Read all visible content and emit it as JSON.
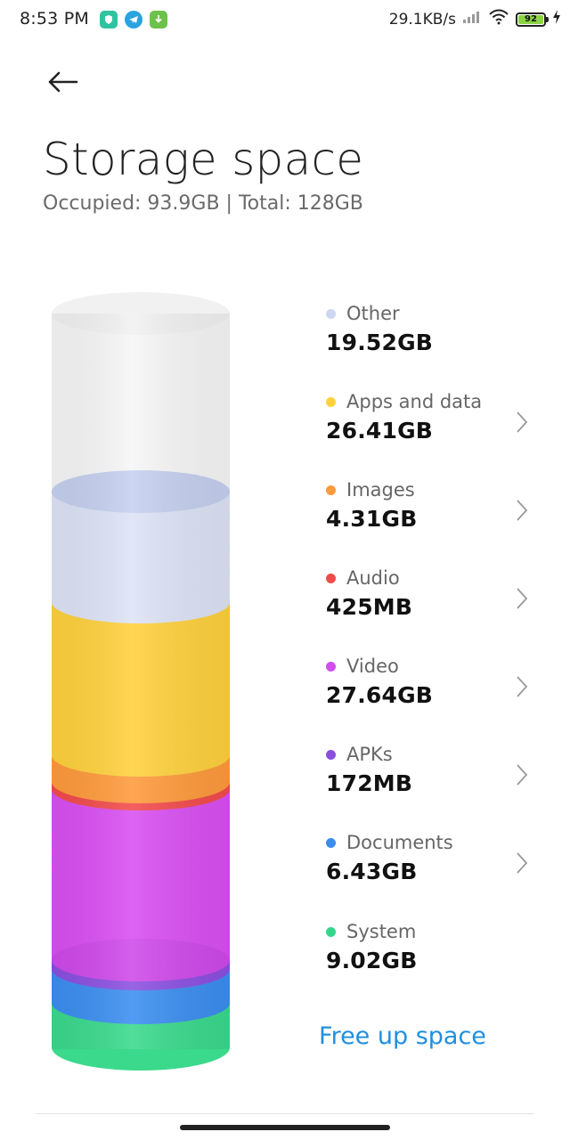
{
  "status_bar": {
    "time": "8:53 PM",
    "net_speed": "29.1KB/s",
    "battery": "92",
    "app_icons": [
      "shield-icon",
      "telegram-icon",
      "download-icon"
    ]
  },
  "header": {
    "title": "Storage space",
    "subtitle": "Occupied: 93.9GB | Total: 128GB"
  },
  "categories": [
    {
      "name": "Other",
      "value": "19.52GB",
      "color": "#cdd7f1",
      "has_arrow": false
    },
    {
      "name": "Apps and data",
      "value": "26.41GB",
      "color": "#ffd13d",
      "has_arrow": true
    },
    {
      "name": "Images",
      "value": "4.31GB",
      "color": "#ff9a3c",
      "has_arrow": true
    },
    {
      "name": "Audio",
      "value": "425MB",
      "color": "#f24b4b",
      "has_arrow": true
    },
    {
      "name": "Video",
      "value": "27.64GB",
      "color": "#d04ef0",
      "has_arrow": true
    },
    {
      "name": "APKs",
      "value": "172MB",
      "color": "#8b4fe0",
      "has_arrow": true
    },
    {
      "name": "Documents",
      "value": "6.43GB",
      "color": "#3b8ef0",
      "has_arrow": true
    },
    {
      "name": "System",
      "value": "9.02GB",
      "color": "#35d68a",
      "has_arrow": false
    }
  ],
  "actions": {
    "free_up_label": "Free up space"
  }
}
